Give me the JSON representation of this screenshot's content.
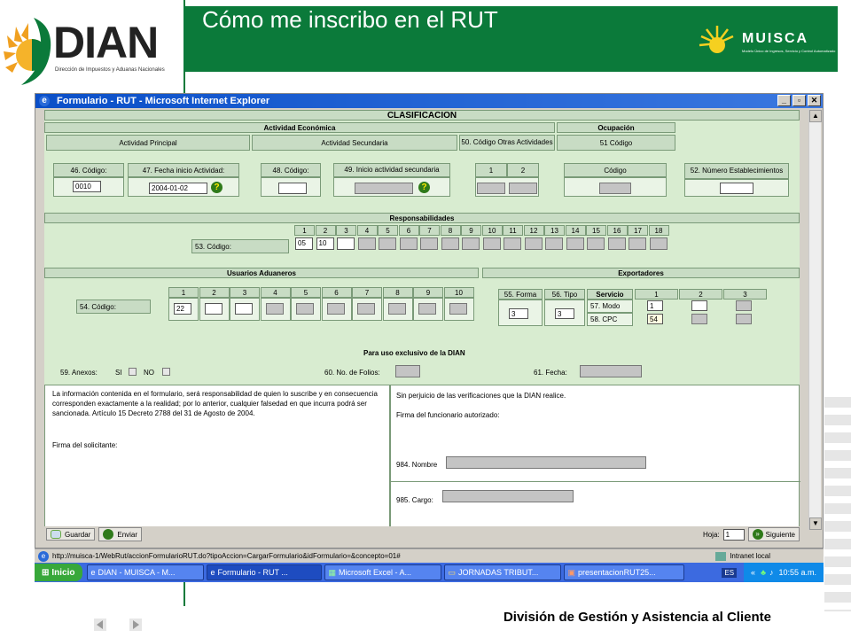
{
  "slide": {
    "title": "Cómo me inscribo en el RUT",
    "footer": "División de Gestión y Asistencia al Cliente",
    "logo_text": "DIAN",
    "logo_subtitle": "Dirección de Impuestos y Aduanas Nacionales",
    "muisca_text": "MUISCA",
    "muisca_subtitle": "Modelo Único de Ingresos, Servicio y Control Automatizado"
  },
  "window": {
    "title": "Formulario - RUT - Microsoft Internet Explorer",
    "minimize": "_",
    "restore": "▫",
    "close": "✕"
  },
  "form": {
    "section": "CLASIFICACION",
    "actividad_economica": "Actividad Económica",
    "ocupacion": "Ocupación",
    "actividad_principal": "Actividad Principal",
    "actividad_secundaria": "Actividad Secundaria",
    "codigo_otras": "50. Código Otras Actividades",
    "codigo_51": "51 Código",
    "f46": "46. Código:",
    "f46_value": "0010",
    "f47": "47. Fecha inicio Actividad:",
    "f47_value": "2004-01-02",
    "f48": "48. Código:",
    "f49": "49. Inicio actividad secundaria",
    "col1": "1",
    "col2": "2",
    "codigo": "Código",
    "f52": "52. Número Establecimientos",
    "responsabilidades": "Responsabilidades",
    "f53": "53. Código:",
    "resp_cols": [
      "1",
      "2",
      "3",
      "4",
      "5",
      "6",
      "7",
      "8",
      "9",
      "10",
      "11",
      "12",
      "13",
      "14",
      "15",
      "16",
      "17",
      "18"
    ],
    "resp_values": [
      "05",
      "10"
    ],
    "usuarios_aduaneros": "Usuarios Aduaneros",
    "exportadores": "Exportadores",
    "f54": "54. Código:",
    "adu_cols": [
      "1",
      "2",
      "3",
      "4",
      "5",
      "6",
      "7",
      "8",
      "9",
      "10"
    ],
    "adu_value": "22",
    "f55": "55. Forma",
    "f56": "56. Tipo",
    "servicio": "Servicio",
    "exp_cols": [
      "1",
      "2",
      "3"
    ],
    "f55_value": "3",
    "f56_value": "3",
    "f57": "57. Modo",
    "f57_value": "1",
    "f58": "58. CPC",
    "f58_value": "54",
    "uso_exclusivo": "Para uso exclusivo de la DIAN",
    "f59": "59. Anexos:",
    "si": "SI",
    "no": "NO",
    "f60": "60. No. de Folios:",
    "f61": "61. Fecha:",
    "legal_text": "La información contenida en el formulario, será responsabilidad de quien lo suscribe y en consecuencia corresponden exactamente a la realidad; por lo anterior, cualquier falsedad en que incurra podrá ser sancionada. Artículo 15 Decreto 2788 del 31 de Agosto de 2004.",
    "firma_solicitante": "Firma del solicitante:",
    "verificaciones": "Sin perjuicio de las verificaciones que la DIAN realice.",
    "firma_funcionario": "Firma del funcionario autorizado:",
    "f984": "984. Nombre",
    "f985": "985. Cargo:"
  },
  "toolbar": {
    "guardar": "Guardar",
    "enviar": "Enviar",
    "hoja": "Hoja:",
    "hoja_value": "1",
    "siguiente": "Siguiente"
  },
  "status": {
    "url": "http://muisca-1/WebRut/accionFormularioRUT.do?tipoAccion=CargarFormulario&idFormulario=&concepto=01#",
    "zone": "Intranet local"
  },
  "taskbar": {
    "start": "Inicio",
    "tasks": [
      "DIAN - MUISCA - M...",
      "Formulario - RUT ...",
      "Microsoft Excel - A...",
      "JORNADAS TRIBUT...",
      "presentacionRUT25..."
    ],
    "lang": "ES",
    "clock": "10:55 a.m."
  },
  "colors": {
    "brand_green": "#0b7a3a",
    "form_bg": "#d8ecd0",
    "xp_blue": "#3c6ae0"
  }
}
